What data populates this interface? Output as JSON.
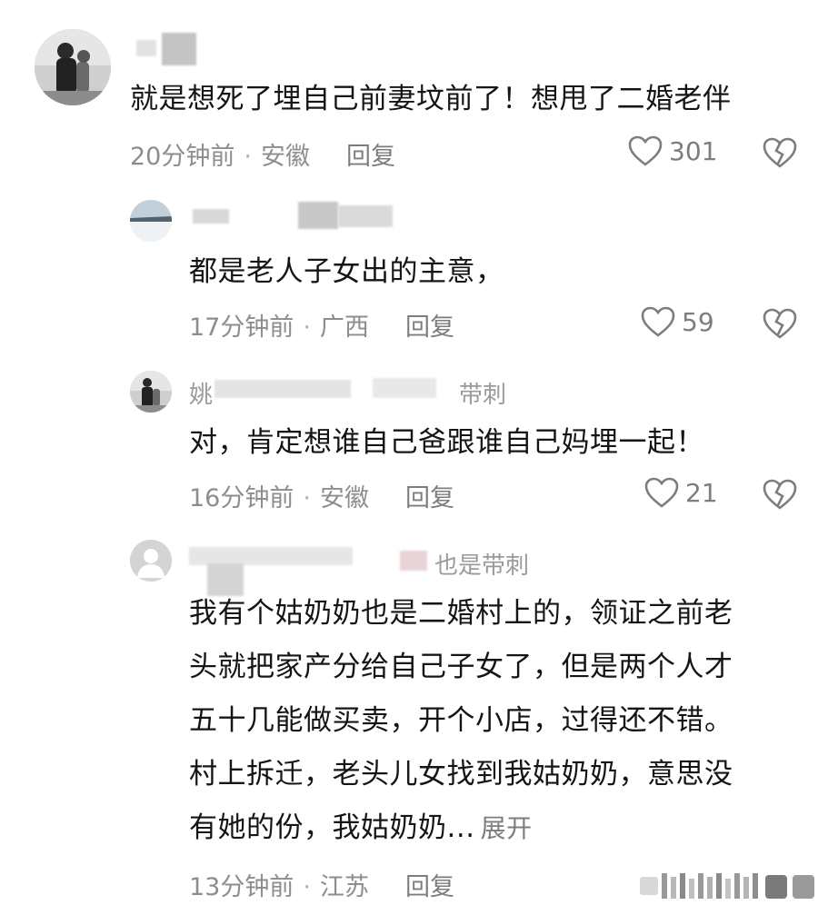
{
  "comments": [
    {
      "username": "",
      "content": "就是想死了埋自己前妻坟前了！想甩了二婚老伴",
      "time": "20分钟前",
      "location": "安徽",
      "reply_label": "回复",
      "likes": "301"
    },
    {
      "username": "",
      "content": "都是老人子女出的主意，",
      "time": "17分钟前",
      "location": "广西",
      "reply_label": "回复",
      "likes": "59"
    },
    {
      "username": "姚",
      "username_suffix": "带刺",
      "content": "对，肯定想谁自己爸跟谁自己妈埋一起！",
      "time": "16分钟前",
      "location": "安徽",
      "reply_label": "回复",
      "likes": "21"
    },
    {
      "username": "",
      "username_suffix": "也是带刺",
      "content_lines": [
        "我有个姑奶奶也是二婚村上的，领证之前老",
        "头就把家产分给自己子女了，但是两个人才",
        "五十几能做买卖，开个小店，过得还不错。",
        "村上拆迁，老头儿女找到我姑奶奶，意思没",
        "有她的份，我姑奶奶..."
      ],
      "expand_label": "展开",
      "time": "13分钟前",
      "location": "江苏",
      "reply_label": "回复"
    }
  ],
  "separator": "·",
  "icons": {
    "like": "heart-outline-icon",
    "dislike": "broken-heart-icon",
    "default_avatar": "person-avatar-icon"
  },
  "colors": {
    "text": "#151515",
    "meta": "#8d8d8d",
    "icon": "#7d7d7d"
  }
}
